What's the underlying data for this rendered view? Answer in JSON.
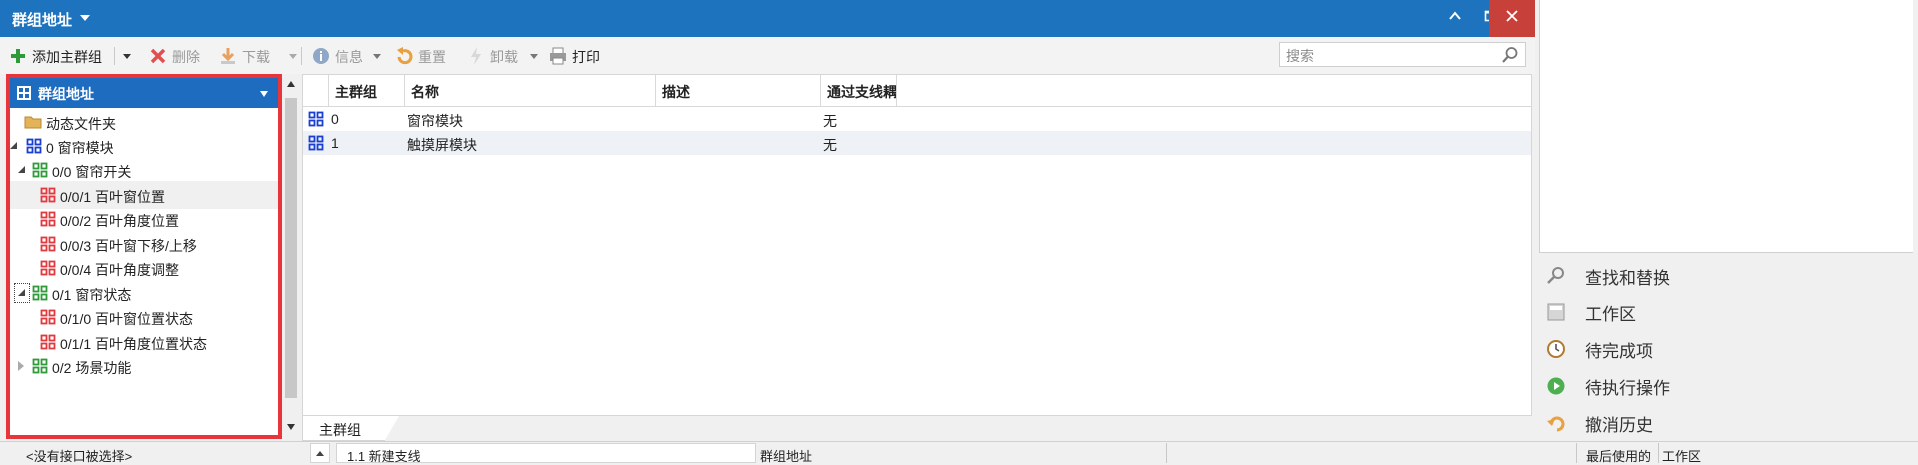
{
  "window": {
    "title": "群组地址"
  },
  "toolbar": {
    "add_main_group": "添加主群组",
    "delete": "删除",
    "download": "下载",
    "info": "信息",
    "reset": "重置",
    "unload": "卸载",
    "print": "打印",
    "search_placeholder": "搜索"
  },
  "tree": {
    "header": "群组地址",
    "nodes": [
      {
        "label": "动态文件夹"
      },
      {
        "label": "0 窗帘模块"
      },
      {
        "label": "0/0 窗帘开关"
      },
      {
        "label": "0/0/1 百叶窗位置"
      },
      {
        "label": "0/0/2 百叶角度位置"
      },
      {
        "label": "0/0/3 百叶窗下移/上移"
      },
      {
        "label": "0/0/4 百叶角度调整"
      },
      {
        "label": "0/1 窗帘状态"
      },
      {
        "label": "0/1/0 百叶窗位置状态"
      },
      {
        "label": "0/1/1 百叶角度位置状态"
      },
      {
        "label": "0/2 场景功能"
      }
    ]
  },
  "grid": {
    "columns": [
      "主群组",
      "名称",
      "描述",
      "通过支线耦"
    ],
    "rows": [
      {
        "main": "0",
        "name": "窗帘模块",
        "desc": "",
        "pass": "无"
      },
      {
        "main": "1",
        "name": "触摸屏模块",
        "desc": "",
        "pass": "无"
      }
    ]
  },
  "tabs": {
    "main_group": "主群组"
  },
  "right_panel": {
    "items": [
      {
        "label": "查找和替换",
        "icon": "search-replace-icon"
      },
      {
        "label": "工作区",
        "icon": "workspace-icon"
      },
      {
        "label": "待完成项",
        "icon": "clock-icon"
      },
      {
        "label": "待执行操作",
        "icon": "play-icon"
      },
      {
        "label": "撤消历史",
        "icon": "undo-icon"
      }
    ]
  },
  "status": {
    "no_interface": "<没有接口被选择>",
    "line": "1.1 新建支线",
    "context": "群组地址",
    "last_used": "最后使用的",
    "workspace": "工作区"
  },
  "colors": {
    "title_bar": "#1e73be",
    "close_button": "#c8403a",
    "tree_highlight_border": "#e8353b",
    "main_group_icon": "#1a3fd0",
    "middle_group_icon": "#2f9a3a",
    "address_icon": "#e0393e"
  }
}
